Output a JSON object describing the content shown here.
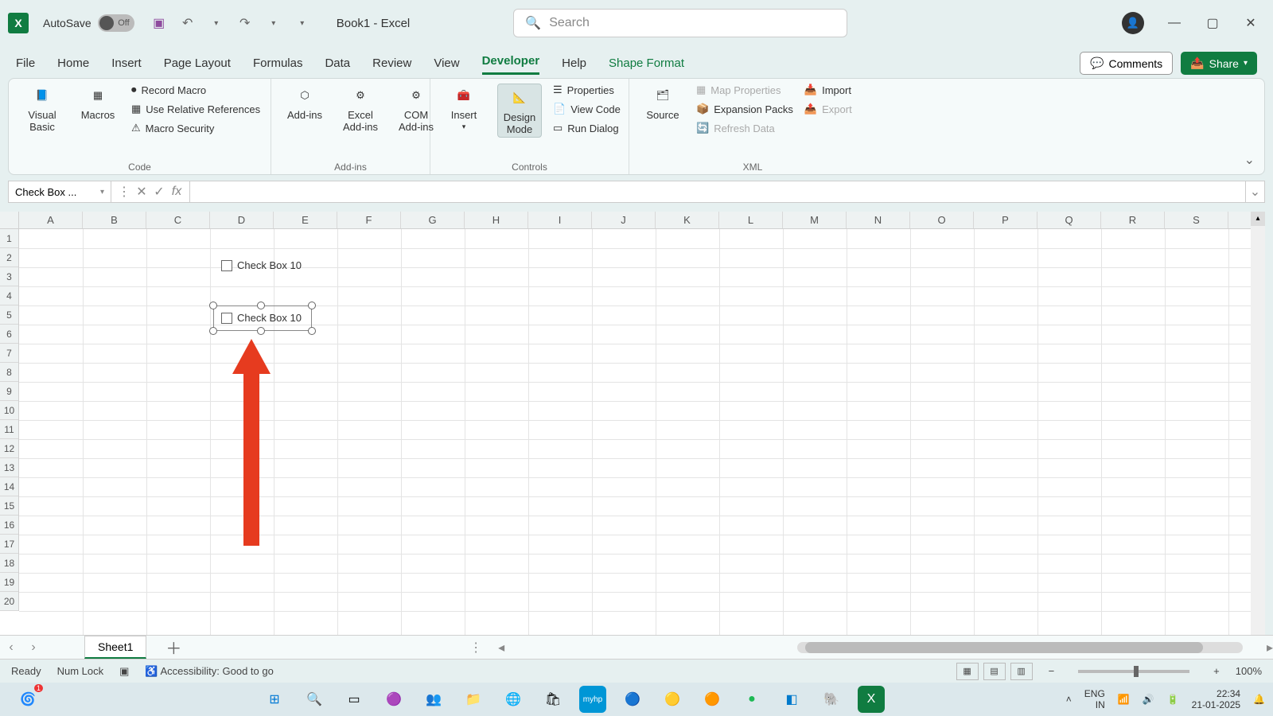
{
  "title": {
    "autosave": "AutoSave",
    "autosave_state": "Off",
    "doc": "Book1  -  Excel",
    "search_placeholder": "Search"
  },
  "tabs": [
    "File",
    "Home",
    "Insert",
    "Page Layout",
    "Formulas",
    "Data",
    "Review",
    "View",
    "Developer",
    "Help",
    "Shape Format"
  ],
  "active_tab": "Developer",
  "comments": "Comments",
  "share": "Share",
  "ribbon": {
    "code": {
      "vb": "Visual Basic",
      "macros": "Macros",
      "record": "Record Macro",
      "relref": "Use Relative References",
      "security": "Macro Security",
      "label": "Code"
    },
    "addins": {
      "addins": "Add-ins",
      "excel": "Excel Add-ins",
      "com": "COM Add-ins",
      "label": "Add-ins"
    },
    "controls": {
      "insert": "Insert",
      "design": "Design Mode",
      "props": "Properties",
      "viewcode": "View Code",
      "rundlg": "Run Dialog",
      "label": "Controls"
    },
    "xml": {
      "source": "Source",
      "mapprops": "Map Properties",
      "expacks": "Expansion Packs",
      "refresh": "Refresh Data",
      "import": "Import",
      "export": "Export",
      "label": "XML"
    }
  },
  "namebox": "Check Box ...",
  "cols": [
    "A",
    "B",
    "C",
    "D",
    "E",
    "F",
    "G",
    "H",
    "I",
    "J",
    "K",
    "L",
    "M",
    "N",
    "O",
    "P",
    "Q",
    "R",
    "S"
  ],
  "rows": [
    "1",
    "2",
    "3",
    "4",
    "5",
    "6",
    "7",
    "8",
    "9",
    "10",
    "11",
    "12",
    "13",
    "14",
    "15",
    "16",
    "17",
    "18",
    "19",
    "20"
  ],
  "checkbox1": "Check Box 10",
  "checkbox2": "Check Box 10",
  "sheet": "Sheet1",
  "status": {
    "ready": "Ready",
    "numlock": "Num Lock",
    "access": "Accessibility: Good to go",
    "zoom": "100%"
  },
  "sys": {
    "lang1": "ENG",
    "lang2": "IN",
    "time": "22:34",
    "date": "21-01-2025"
  }
}
